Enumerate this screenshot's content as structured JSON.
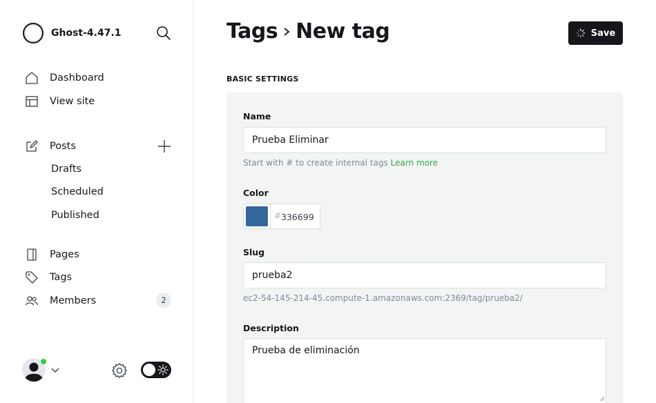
{
  "app": {
    "title": "Ghost-4.47.1"
  },
  "sidebar": {
    "nav": [
      {
        "label": "Dashboard",
        "icon": "home-icon"
      },
      {
        "label": "View site",
        "icon": "layout-icon"
      }
    ],
    "posts": {
      "label": "Posts",
      "icon": "pencil-edit-icon",
      "sub": [
        {
          "label": "Drafts"
        },
        {
          "label": "Scheduled"
        },
        {
          "label": "Published"
        }
      ]
    },
    "pages": {
      "label": "Pages",
      "icon": "page-icon"
    },
    "tags": {
      "label": "Tags",
      "icon": "tag-icon"
    },
    "members": {
      "label": "Members",
      "icon": "members-icon",
      "count": "2"
    }
  },
  "header": {
    "crumb_parent": "Tags",
    "crumb_current": "New tag",
    "save_label": "Save"
  },
  "form": {
    "section_title": "BASIC SETTINGS",
    "name": {
      "label": "Name",
      "value": "Prueba Eliminar",
      "hint": "Start with # to create internal tags",
      "hint_link": "Learn more"
    },
    "color": {
      "label": "Color",
      "hash": "#",
      "hex": "336699",
      "swatch": "#336699"
    },
    "slug": {
      "label": "Slug",
      "value": "prueba2",
      "url": "ec2-54-145-214-45.compute-1.amazonaws.com:2369/tag/prueba2/"
    },
    "description": {
      "label": "Description",
      "value": "Prueba de eliminación"
    }
  },
  "colors": {
    "accent_green": "#30a44f",
    "online_dot": "#30cf43",
    "dark": "#15171a",
    "panel_bg": "#f3f4f4"
  }
}
